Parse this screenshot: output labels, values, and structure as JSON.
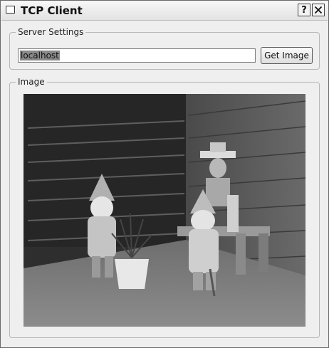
{
  "window": {
    "title": "TCP Client",
    "help_glyph": "?"
  },
  "server_settings": {
    "legend": "Server Settings",
    "host_value": "localhost",
    "get_image_label": "Get Image"
  },
  "image_group": {
    "legend": "Image"
  },
  "icons": {
    "window": "window-icon",
    "help": "help-icon",
    "close": "close-icon"
  }
}
